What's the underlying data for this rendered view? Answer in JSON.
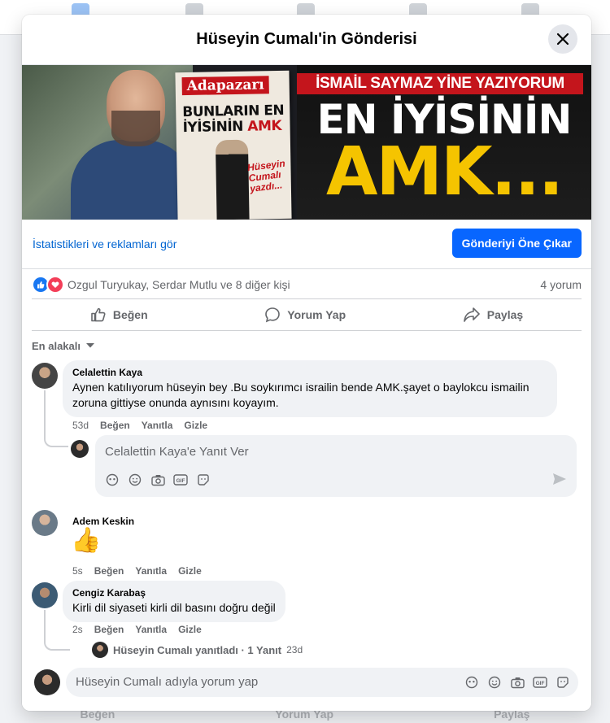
{
  "background": {
    "bottom_actions": [
      "Beğen",
      "Yorum Yap",
      "Paylaş"
    ]
  },
  "modal": {
    "title": "Hüseyin Cumalı'in Gönderisi",
    "close_icon": "close-icon"
  },
  "post_image": {
    "newspaper_masthead": "Adapazarı",
    "newspaper_headline_line1": "BUNLARIN EN",
    "newspaper_headline_line2": "İYİSİNİN",
    "newspaper_headline_red": "AMK",
    "newspaper_byline": "Hüseyin Cumalı yazdı...",
    "banner_top": "İSMAİL SAYMAZ YİNE YAZIYORUM",
    "banner_mid": "EN İYİSİNİN",
    "banner_bottom": "AMK..."
  },
  "stats": {
    "insights_link": "İstatistikleri ve reklamları gör",
    "boost_button": "Gönderiyi Öne Çıkar"
  },
  "reactions": {
    "icons": [
      "like-icon",
      "love-icon"
    ],
    "names": "Ozgul Turyukay, Serdar Mutlu ve 8 diğer kişi",
    "comment_count": "4 yorum"
  },
  "actions": {
    "like": "Beğen",
    "comment": "Yorum Yap",
    "share": "Paylaş"
  },
  "sort": {
    "label": "En alakalı"
  },
  "comments": [
    {
      "author": "Celalettin Kaya",
      "text": "Aynen katılıyorum hüseyin bey .Bu soykırımcı israilin bende AMK.şayet o baylokcu ismailin zoruna gittiyse onunda aynısını koyayım.",
      "time": "53d",
      "like": "Beğen",
      "reply": "Yanıtla",
      "hide": "Gizle"
    },
    {
      "author": "Adem Keskin",
      "text": "👍",
      "time": "5s",
      "like": "Beğen",
      "reply": "Yanıtla",
      "hide": "Gizle"
    },
    {
      "author": "Cengiz Karabaş",
      "text": "Kirli dil siyaseti kirli dil basını doğru değil",
      "time": "2s",
      "like": "Beğen",
      "reply": "Yanıtla",
      "hide": "Gizle"
    }
  ],
  "reply_box": {
    "placeholder": "Celalettin Kaya'e Yanıt Ver"
  },
  "replies_link": {
    "text": "Hüseyin Cumalı yanıtladı · 1 Yanıt",
    "age": "23d"
  },
  "compose": {
    "placeholder": "Hüseyin Cumalı adıyla yorum yap"
  }
}
